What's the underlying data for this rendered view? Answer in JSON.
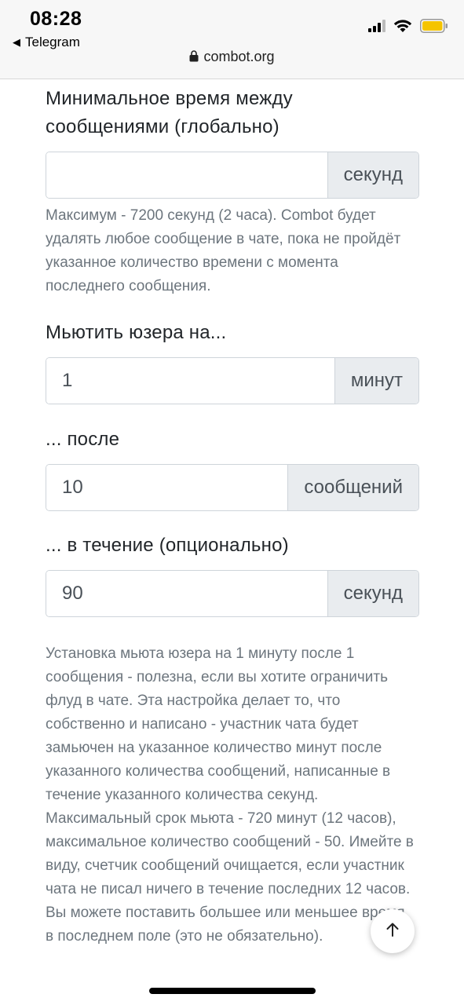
{
  "status_bar": {
    "time": "08:28",
    "back_app": "Telegram",
    "signal_icon": "cellular-signal-icon",
    "wifi_icon": "wifi-icon",
    "battery_icon": "battery-icon",
    "battery_color": "#f5c400"
  },
  "browser": {
    "url": "combot.org",
    "lock_icon": "lock-icon"
  },
  "form": {
    "min_time": {
      "label": "Минимальное время между сообщениями (глобально)",
      "value": "",
      "addon": "секунд",
      "help": "Максимум - 7200 секунд (2 часа). Combot будет удалять любое сообщение в чате, пока не пройдёт указанное количество времени с момента последнего сообщения."
    },
    "mute_for": {
      "label": "Мьютить юзера на...",
      "value": "1",
      "addon": "минут"
    },
    "after": {
      "label": "... после",
      "value": "10",
      "addon": "сообщений"
    },
    "during": {
      "label": "... в течение (опционально)",
      "value": "90",
      "addon": "секунд"
    },
    "mute_help": "Установка мьюта юзера на 1 минуту после 1 сообщения - полезна, если вы хотите ограничить флуд в чате. Эта настройка делает то, что собственно и написано - участник чата будет замьючен на указанное количество минут после указанного количества сообщений, написанные в течение указанного количества секунд. Максимальный срок мьюта - 720 минут (12 часов), максимальное количество сообщений - 50. Имейте в виду, счетчик сообщений очищается, если участник чата не писал ничего в течение последних 12 часов. Вы можете поставить большее или меньшее время в последнем поле (это не обязательно)."
  },
  "scroll_top_icon": "arrow-up-icon",
  "colors": {
    "addon_bg": "#e9ecef",
    "border": "#ced4da",
    "help_text": "#6c757d"
  }
}
